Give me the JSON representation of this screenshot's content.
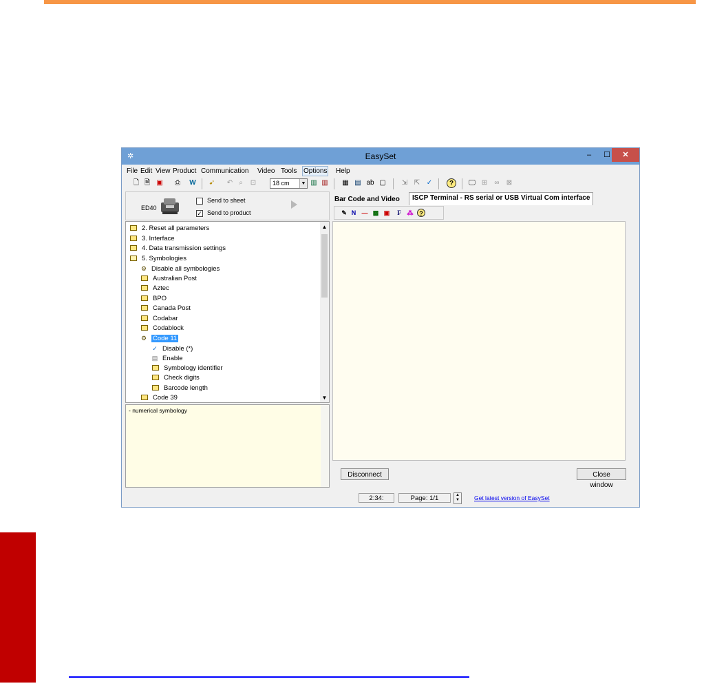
{
  "window": {
    "title": "EasySet",
    "minimize": "–",
    "maximize": "☐",
    "close": "✕"
  },
  "menu": [
    "File",
    "Edit",
    "View",
    "Product",
    "Communication",
    "Video",
    "Tools",
    "Options",
    "Help"
  ],
  "toolbar": {
    "zoom_value": "18 cm"
  },
  "product_panel": {
    "product_label": "ED40",
    "send_to_sheet": {
      "label": "Send to sheet",
      "checked": false
    },
    "send_to_product": {
      "label": "Send to product",
      "checked": true
    }
  },
  "tree": {
    "items": [
      {
        "label": "2. Reset all parameters",
        "icon": "folder",
        "level": 0
      },
      {
        "label": "3. Interface",
        "icon": "folder",
        "level": 0
      },
      {
        "label": "4. Data transmission settings",
        "icon": "folder",
        "level": 0
      },
      {
        "label": "5. Symbologies",
        "icon": "folder-open",
        "level": 0
      },
      {
        "label": "Disable all symbologies",
        "icon": "gear",
        "level": 1
      },
      {
        "label": "Australian Post",
        "icon": "folder",
        "level": 1
      },
      {
        "label": "Aztec",
        "icon": "folder",
        "level": 1
      },
      {
        "label": "BPO",
        "icon": "folder",
        "level": 1
      },
      {
        "label": "Canada Post",
        "icon": "folder",
        "level": 1
      },
      {
        "label": "Codabar",
        "icon": "folder",
        "level": 1
      },
      {
        "label": "Codablock",
        "icon": "folder",
        "level": 1
      },
      {
        "label": "Code 11",
        "icon": "folder-open",
        "level": 1,
        "selected": true
      },
      {
        "label": "Disable (*)",
        "icon": "check",
        "level": 2
      },
      {
        "label": "Enable",
        "icon": "setting",
        "level": 2
      },
      {
        "label": "Symbology identifier",
        "icon": "folder",
        "level": 2
      },
      {
        "label": "Check digits",
        "icon": "folder",
        "level": 2
      },
      {
        "label": "Barcode length",
        "icon": "folder",
        "level": 2
      },
      {
        "label": "Code 39",
        "icon": "folder",
        "level": 1
      }
    ]
  },
  "description": {
    "text": "- numerical symbology"
  },
  "tabs": [
    {
      "label": "Bar Code and Video",
      "active": false
    },
    {
      "label": "ISCP Terminal - RS serial or USB Virtual Com interface",
      "active": true
    }
  ],
  "terminal": {
    "disconnect_label": "Disconnect",
    "close_label": "Close window"
  },
  "status": {
    "time": "2:34:",
    "page": "Page: 1/1",
    "link": "Get latest version of EasySet"
  }
}
